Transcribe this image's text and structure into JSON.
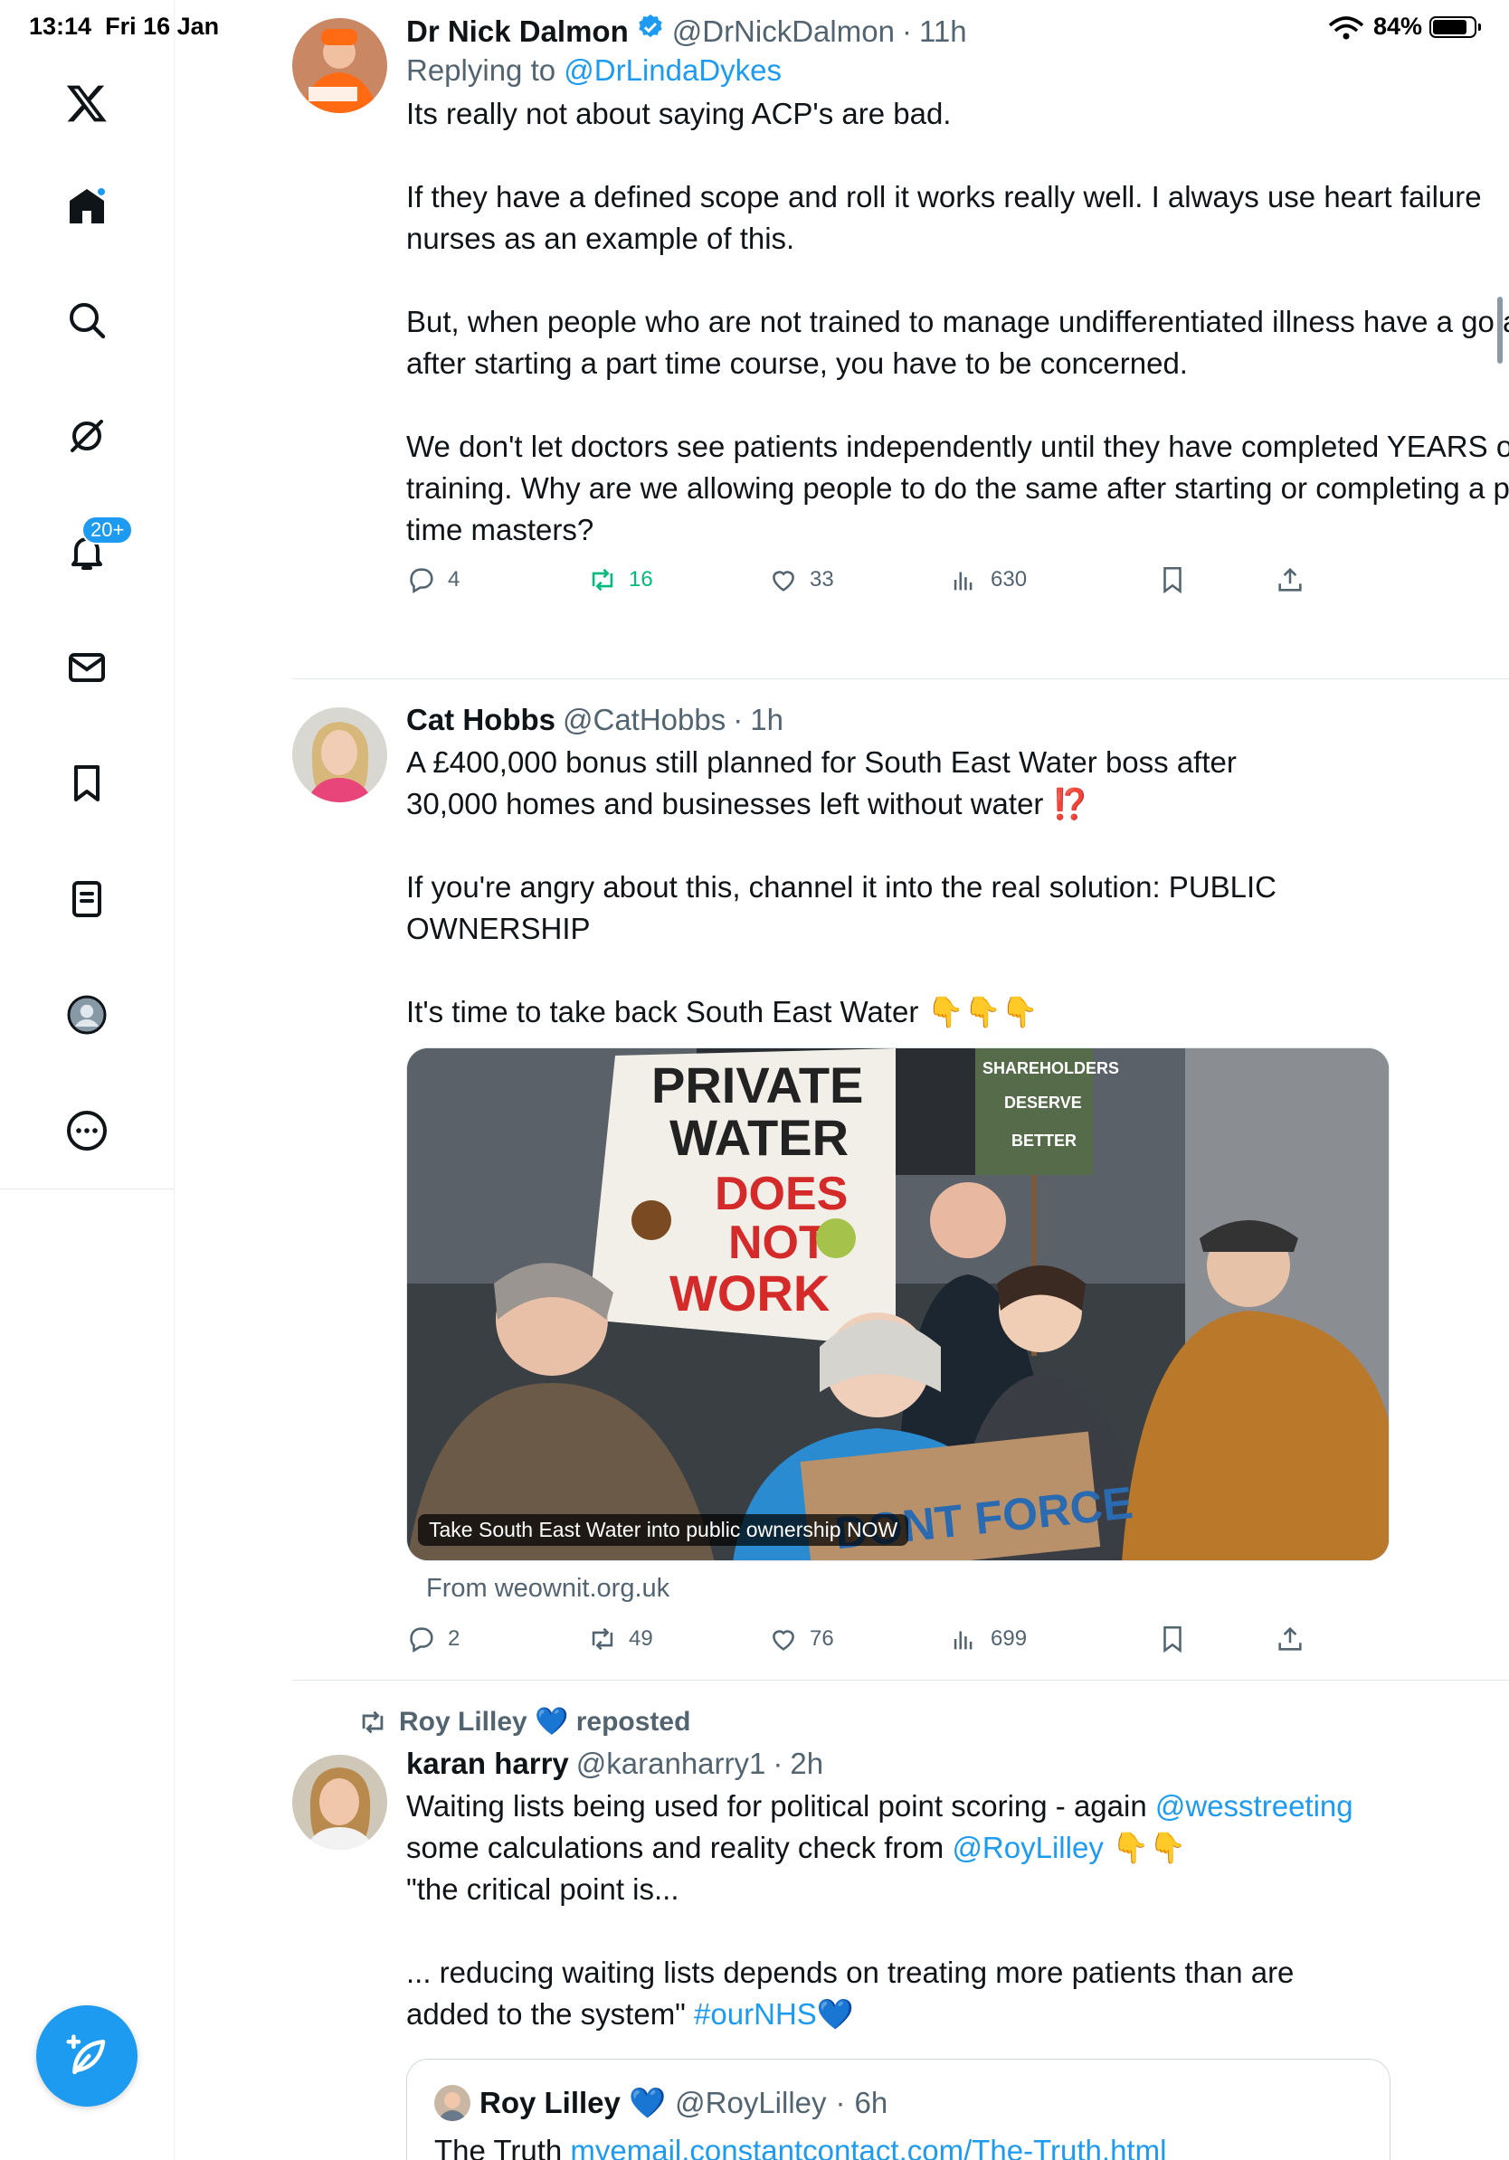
{
  "status_bar": {
    "time": "13:14",
    "date": "Fri 16 Jan",
    "battery": "84%"
  },
  "nav": {
    "items": [
      "Home",
      "Search",
      "Grok",
      "Notifications",
      "Messages",
      "Bookmarks",
      "Lists",
      "Profile",
      "More"
    ],
    "notifications_badge": "20+",
    "compose_label": "Post"
  },
  "tweets": [
    {
      "name": "Dr Nick Dalmon",
      "handle": "@DrNickDalmon",
      "time": "11h",
      "verified": true,
      "replying_prefix": "Replying to ",
      "replying_to": "@DrLindaDykes",
      "paragraphs": [
        "Its really not about saying ACP's are bad.",
        "",
        "If they have a defined scope and roll it works really well. I always use heart failure nurses as an example of this.",
        "",
        "But, when people who are not trained to manage undifferentiated illness have a go at it after starting a part time course, you have to be concerned.",
        "",
        "We don't let doctors see patients independently until they have completed YEARS of training. Why are we allowing people to do the same after starting or completing a part time masters?"
      ],
      "stats": {
        "replies": "4",
        "reposts": "16",
        "likes": "33",
        "views": "630"
      }
    },
    {
      "name": "Cat Hobbs",
      "handle": "@CatHobbs",
      "time": "1h",
      "line1": "A £400,000 bonus still planned for South East Water boss after",
      "line2": "30,000 homes and businesses left without water ⁉️",
      "line3": "If you're angry about this, channel it into the real solution: PUBLIC",
      "line4": "OWNERSHIP",
      "line5": "It's time to take back South East Water 👇👇👇",
      "media": {
        "caption": "Take South East Water into public ownership NOW",
        "source": "From weownit.org.uk",
        "sign_main": [
          "PRIVATE",
          "WATER",
          "DOES",
          "NOT",
          "WORK"
        ],
        "sign_small": [
          "SHAREHOLDERS",
          "DESERVE",
          "BETTER"
        ],
        "sign_bottom": "DONT FORCE"
      },
      "stats": {
        "replies": "2",
        "reposts": "49",
        "likes": "76",
        "views": "699"
      }
    },
    {
      "reposted_by": "Roy Lilley 💙 reposted",
      "name": "karan harry",
      "handle": "@karanharry1",
      "time": "2h",
      "line1_text": "Waiting lists being used for political point scoring - again ",
      "line1_link": "@wesstreeting",
      "line2_text": "some calculations and reality check from ",
      "line2_link": "@RoyLilley",
      "line2_emoji": " 👇👇",
      "line3": "\"the critical point is...",
      "line4": "... reducing waiting lists depends on treating more patients than are",
      "line5_text": "added to the system\" ",
      "line5_link": "#ourNHS",
      "line5_emoji": "💙",
      "quote": {
        "name": "Roy Lilley 💙",
        "handle": "@RoyLilley",
        "time": "6h",
        "text_prefix": "The Truth ",
        "link": "myemail.constantcontact.com/The-Truth.html"
      }
    }
  ],
  "colors": {
    "accent": "#1d9bf0",
    "repost_green": "#00ba7c",
    "muted": "#536471"
  }
}
